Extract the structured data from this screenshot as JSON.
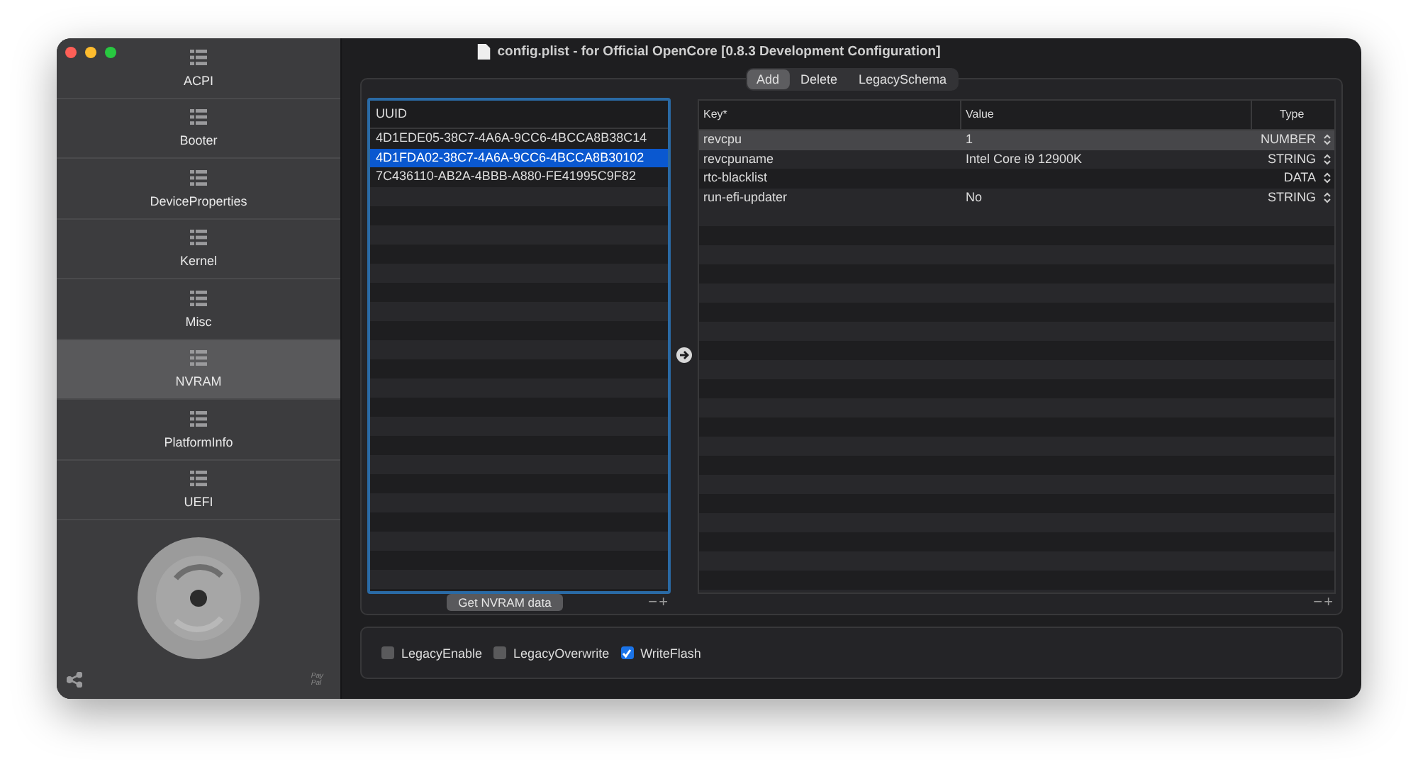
{
  "window": {
    "title": "config.plist - for Official OpenCore [0.8.3 Development Configuration]"
  },
  "sidebar": {
    "items": [
      {
        "label": "ACPI",
        "selected": false
      },
      {
        "label": "Booter",
        "selected": false
      },
      {
        "label": "DeviceProperties",
        "selected": false
      },
      {
        "label": "Kernel",
        "selected": false
      },
      {
        "label": "Misc",
        "selected": false
      },
      {
        "label": "NVRAM",
        "selected": true
      },
      {
        "label": "PlatformInfo",
        "selected": false
      },
      {
        "label": "UEFI",
        "selected": false
      }
    ],
    "paypal": [
      "Pay",
      "Pal"
    ]
  },
  "tabs": [
    {
      "label": "Add",
      "selected": true
    },
    {
      "label": "Delete",
      "selected": false
    },
    {
      "label": "LegacySchema",
      "selected": false
    }
  ],
  "uuid_list": {
    "column": "UUID",
    "rows": [
      {
        "uuid": "4D1EDE05-38C7-4A6A-9CC6-4BCCA8B38C14",
        "selected": false
      },
      {
        "uuid": "4D1FDA02-38C7-4A6A-9CC6-4BCCA8B30102",
        "selected": true
      },
      {
        "uuid": "7C436110-AB2A-4BBB-A880-FE41995C9F82",
        "selected": false
      }
    ],
    "button": "Get NVRAM data",
    "remove": "−",
    "add": "+"
  },
  "table": {
    "columns": [
      "Key*",
      "Value",
      "Type"
    ],
    "rows": [
      {
        "key": "revcpu",
        "value": "1",
        "type": "NUMBER",
        "selected": true
      },
      {
        "key": "revcpuname",
        "value": "Intel Core i9 12900K",
        "type": "STRING",
        "selected": false
      },
      {
        "key": "rtc-blacklist",
        "value": "",
        "type": "DATA",
        "selected": false
      },
      {
        "key": "run-efi-updater",
        "value": "No",
        "type": "STRING",
        "selected": false
      }
    ],
    "remove": "−",
    "add": "+"
  },
  "options": [
    {
      "label": "LegacyEnable",
      "checked": false
    },
    {
      "label": "LegacyOverwrite",
      "checked": false
    },
    {
      "label": "WriteFlash",
      "checked": true
    }
  ]
}
